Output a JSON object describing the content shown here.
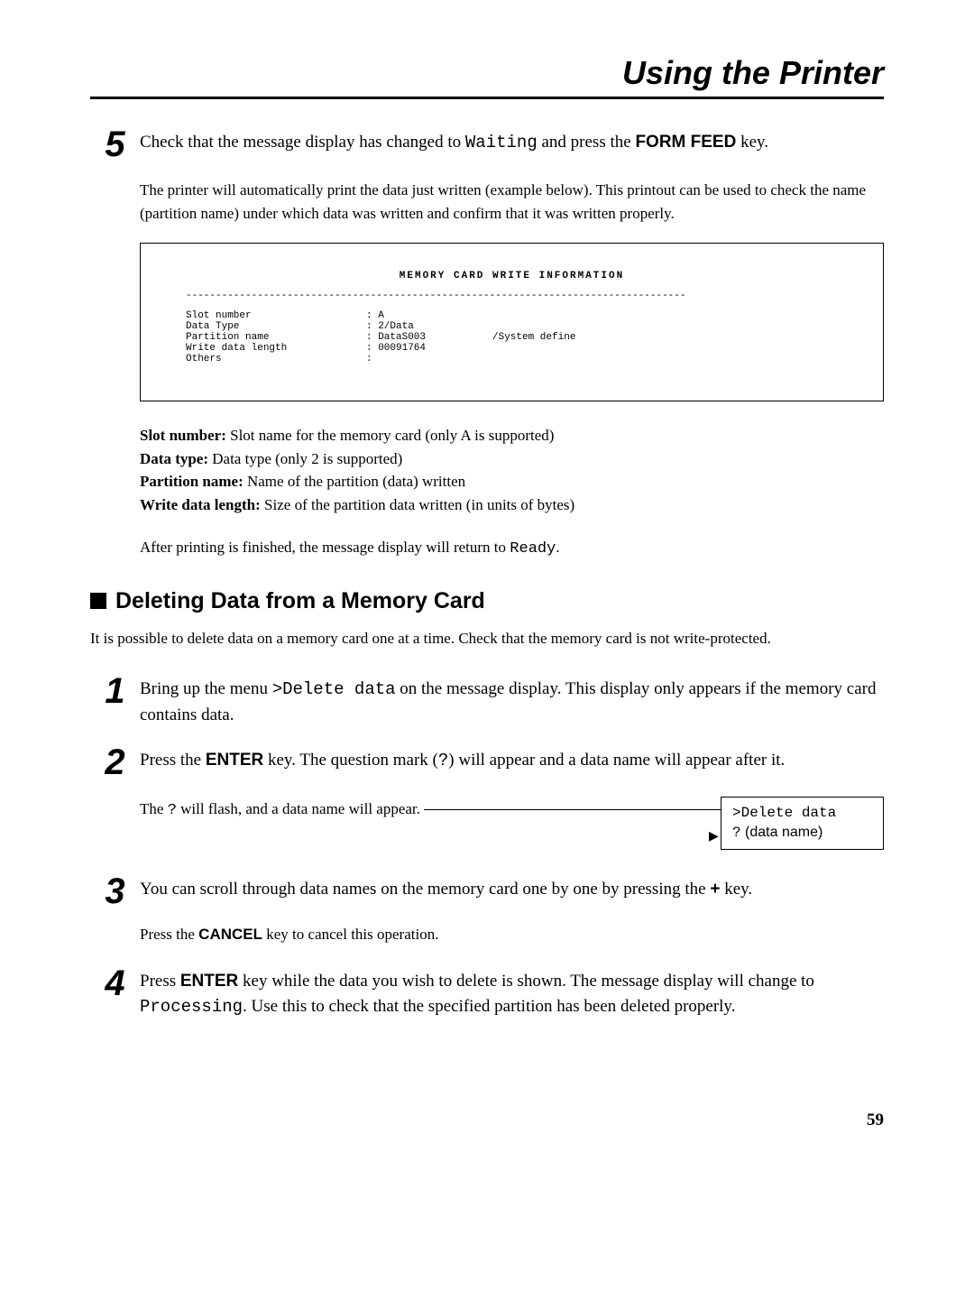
{
  "header": "Using the Printer",
  "step5": {
    "num": "5",
    "text_a": "Check that the message display has changed to ",
    "mono_a": "Waiting",
    "text_b": " and press the ",
    "bold_b": "FORM FEED",
    "text_c": " key."
  },
  "step5_para": "The printer will automatically print the data just written (example below).  This printout can be used to check the name (partition name) under which data was written and confirm that it was written properly.",
  "printout": {
    "title": "MEMORY CARD  WRITE  INFORMATION",
    "dashes": "------------------------------------------------------------------------------------",
    "rows": [
      {
        "c1": "Slot number",
        "c2": ": A",
        "c3": ""
      },
      {
        "c1": "Data Type",
        "c2": ": 2/Data",
        "c3": ""
      },
      {
        "c1": "Partition name",
        "c2": ": DataS003",
        "c3": "/System define"
      },
      {
        "c1": "Write data length",
        "c2": ": 00091764",
        "c3": ""
      },
      {
        "c1": "Others",
        "c2": ":",
        "c3": ""
      }
    ]
  },
  "defs": {
    "slot_label": "Slot number:",
    "slot_text": " Slot name for the memory card (only A is supported)",
    "dtype_label": "Data type:",
    "dtype_text": " Data type (only 2 is supported)",
    "pname_label": "Partition name:",
    "pname_text": " Name of the partition (data) written",
    "wlen_label": "Write data length:",
    "wlen_text": " Size of the partition data written (in units of bytes)"
  },
  "after_print_a": "After printing is finished, the message display will return to  ",
  "after_print_mono": "Ready",
  "after_print_b": ".",
  "h2": "Deleting Data from a Memory Card",
  "intro": "It is possible to delete data on a memory card one at a time.  Check that the memory card is not write-protected.",
  "step1": {
    "num": "1",
    "a": "Bring up the menu ",
    "mono": ">Delete data",
    "b": " on the message display.  This display only appears if the memory card contains data."
  },
  "step2": {
    "num": "2",
    "a": "Press the ",
    "bold": "ENTER",
    "b": " key. The question mark (",
    "mono": "?",
    "c": ") will appear and a data name will appear after it."
  },
  "flash": {
    "a": "The ",
    "mono": "?",
    "b": " will flash, and a data name will appear."
  },
  "display_box": {
    "line1": ">Delete data",
    "line2a": "?",
    "line2b": " (data name)"
  },
  "step3": {
    "num": "3",
    "a": "You can scroll through data names on the memory card one by one by pressing the ",
    "bold": "+",
    "b": " key."
  },
  "step3_note_a": "Press the  ",
  "step3_note_bold": "CANCEL",
  "step3_note_b": " key to cancel this operation.",
  "step4": {
    "num": "4",
    "a": "Press ",
    "bold": "ENTER",
    "b": " key while the data you wish to delete is shown.  The message display will change to ",
    "mono": "Processing",
    "c": ". Use this to check that the specified partition has been deleted properly."
  },
  "page_num": "59"
}
